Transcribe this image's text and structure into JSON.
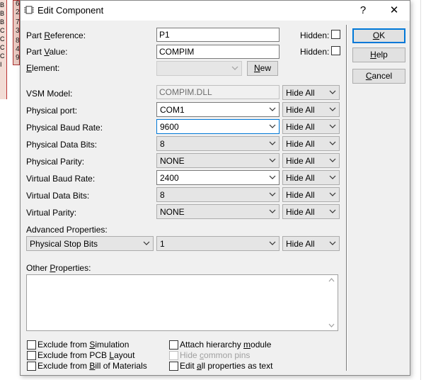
{
  "background": {
    "pin_numbers": [
      "6",
      "2",
      "7",
      "3",
      "8",
      "4",
      "9"
    ],
    "side_letters": [
      "B",
      "B",
      "B",
      "C",
      "C",
      "C",
      "C",
      "I"
    ]
  },
  "dialog": {
    "title": "Edit Component",
    "help_glyph": "?",
    "close_glyph": "✕"
  },
  "fields": {
    "part_reference": {
      "label_pre": "Part ",
      "label_u": "R",
      "label_post": "eference:",
      "value": "P1",
      "hidden_label": "Hidden:"
    },
    "part_value": {
      "label_pre": "Part ",
      "label_u": "V",
      "label_post": "alue:",
      "value": "COMPIM",
      "hidden_label": "Hidden:"
    },
    "element": {
      "label_pre": "",
      "label_u": "E",
      "label_post": "lement:",
      "value": "",
      "new_label_u": "N",
      "new_label_post": "ew"
    }
  },
  "properties": [
    {
      "label": "VSM Model:",
      "value": "COMPIM.DLL",
      "visibility": "Hide All",
      "kind": "text-disabled"
    },
    {
      "label": "Physical port:",
      "value": "COM1",
      "visibility": "Hide All",
      "kind": "combo"
    },
    {
      "label": "Physical Baud Rate:",
      "value": "9600",
      "visibility": "Hide All",
      "kind": "combo-focus"
    },
    {
      "label": "Physical Data Bits:",
      "value": "8",
      "visibility": "Hide All",
      "kind": "combo-gray"
    },
    {
      "label": "Physical Parity:",
      "value": "NONE",
      "visibility": "Hide All",
      "kind": "combo-gray"
    },
    {
      "label": "Virtual Baud Rate:",
      "value": "2400",
      "visibility": "Hide All",
      "kind": "combo"
    },
    {
      "label": "Virtual Data Bits:",
      "value": "8",
      "visibility": "Hide All",
      "kind": "combo-gray"
    },
    {
      "label": "Virtual Parity:",
      "value": "NONE",
      "visibility": "Hide All",
      "kind": "combo-gray"
    }
  ],
  "advanced": {
    "label": "Advanced Properties:",
    "property": "Physical Stop Bits",
    "value": "1",
    "visibility": "Hide All"
  },
  "other_properties": {
    "label_pre": "Other ",
    "label_u": "P",
    "label_post": "roperties:"
  },
  "checkboxes_left": [
    {
      "pre": "Exclude from ",
      "u": "S",
      "post": "imulation"
    },
    {
      "pre": "Exclude from PCB ",
      "u": "L",
      "post": "ayout"
    },
    {
      "pre": "Exclude from ",
      "u": "B",
      "post": "ill of Materials"
    }
  ],
  "checkboxes_right": [
    {
      "pre": "Attach hierarchy ",
      "u": "m",
      "post": "odule",
      "disabled": false
    },
    {
      "pre": "Hide ",
      "u": "c",
      "post": "ommon pins",
      "disabled": true
    },
    {
      "pre": "Edit ",
      "u": "a",
      "post": "ll properties as text",
      "disabled": false
    }
  ],
  "buttons": {
    "ok": {
      "u": "O",
      "post": "K"
    },
    "help": {
      "u": "H",
      "post": "elp"
    },
    "cancel": {
      "u": "C",
      "post": "ancel"
    }
  },
  "colors": {
    "accent": "#0078d7",
    "dialog_bg": "#f0f0f0"
  }
}
